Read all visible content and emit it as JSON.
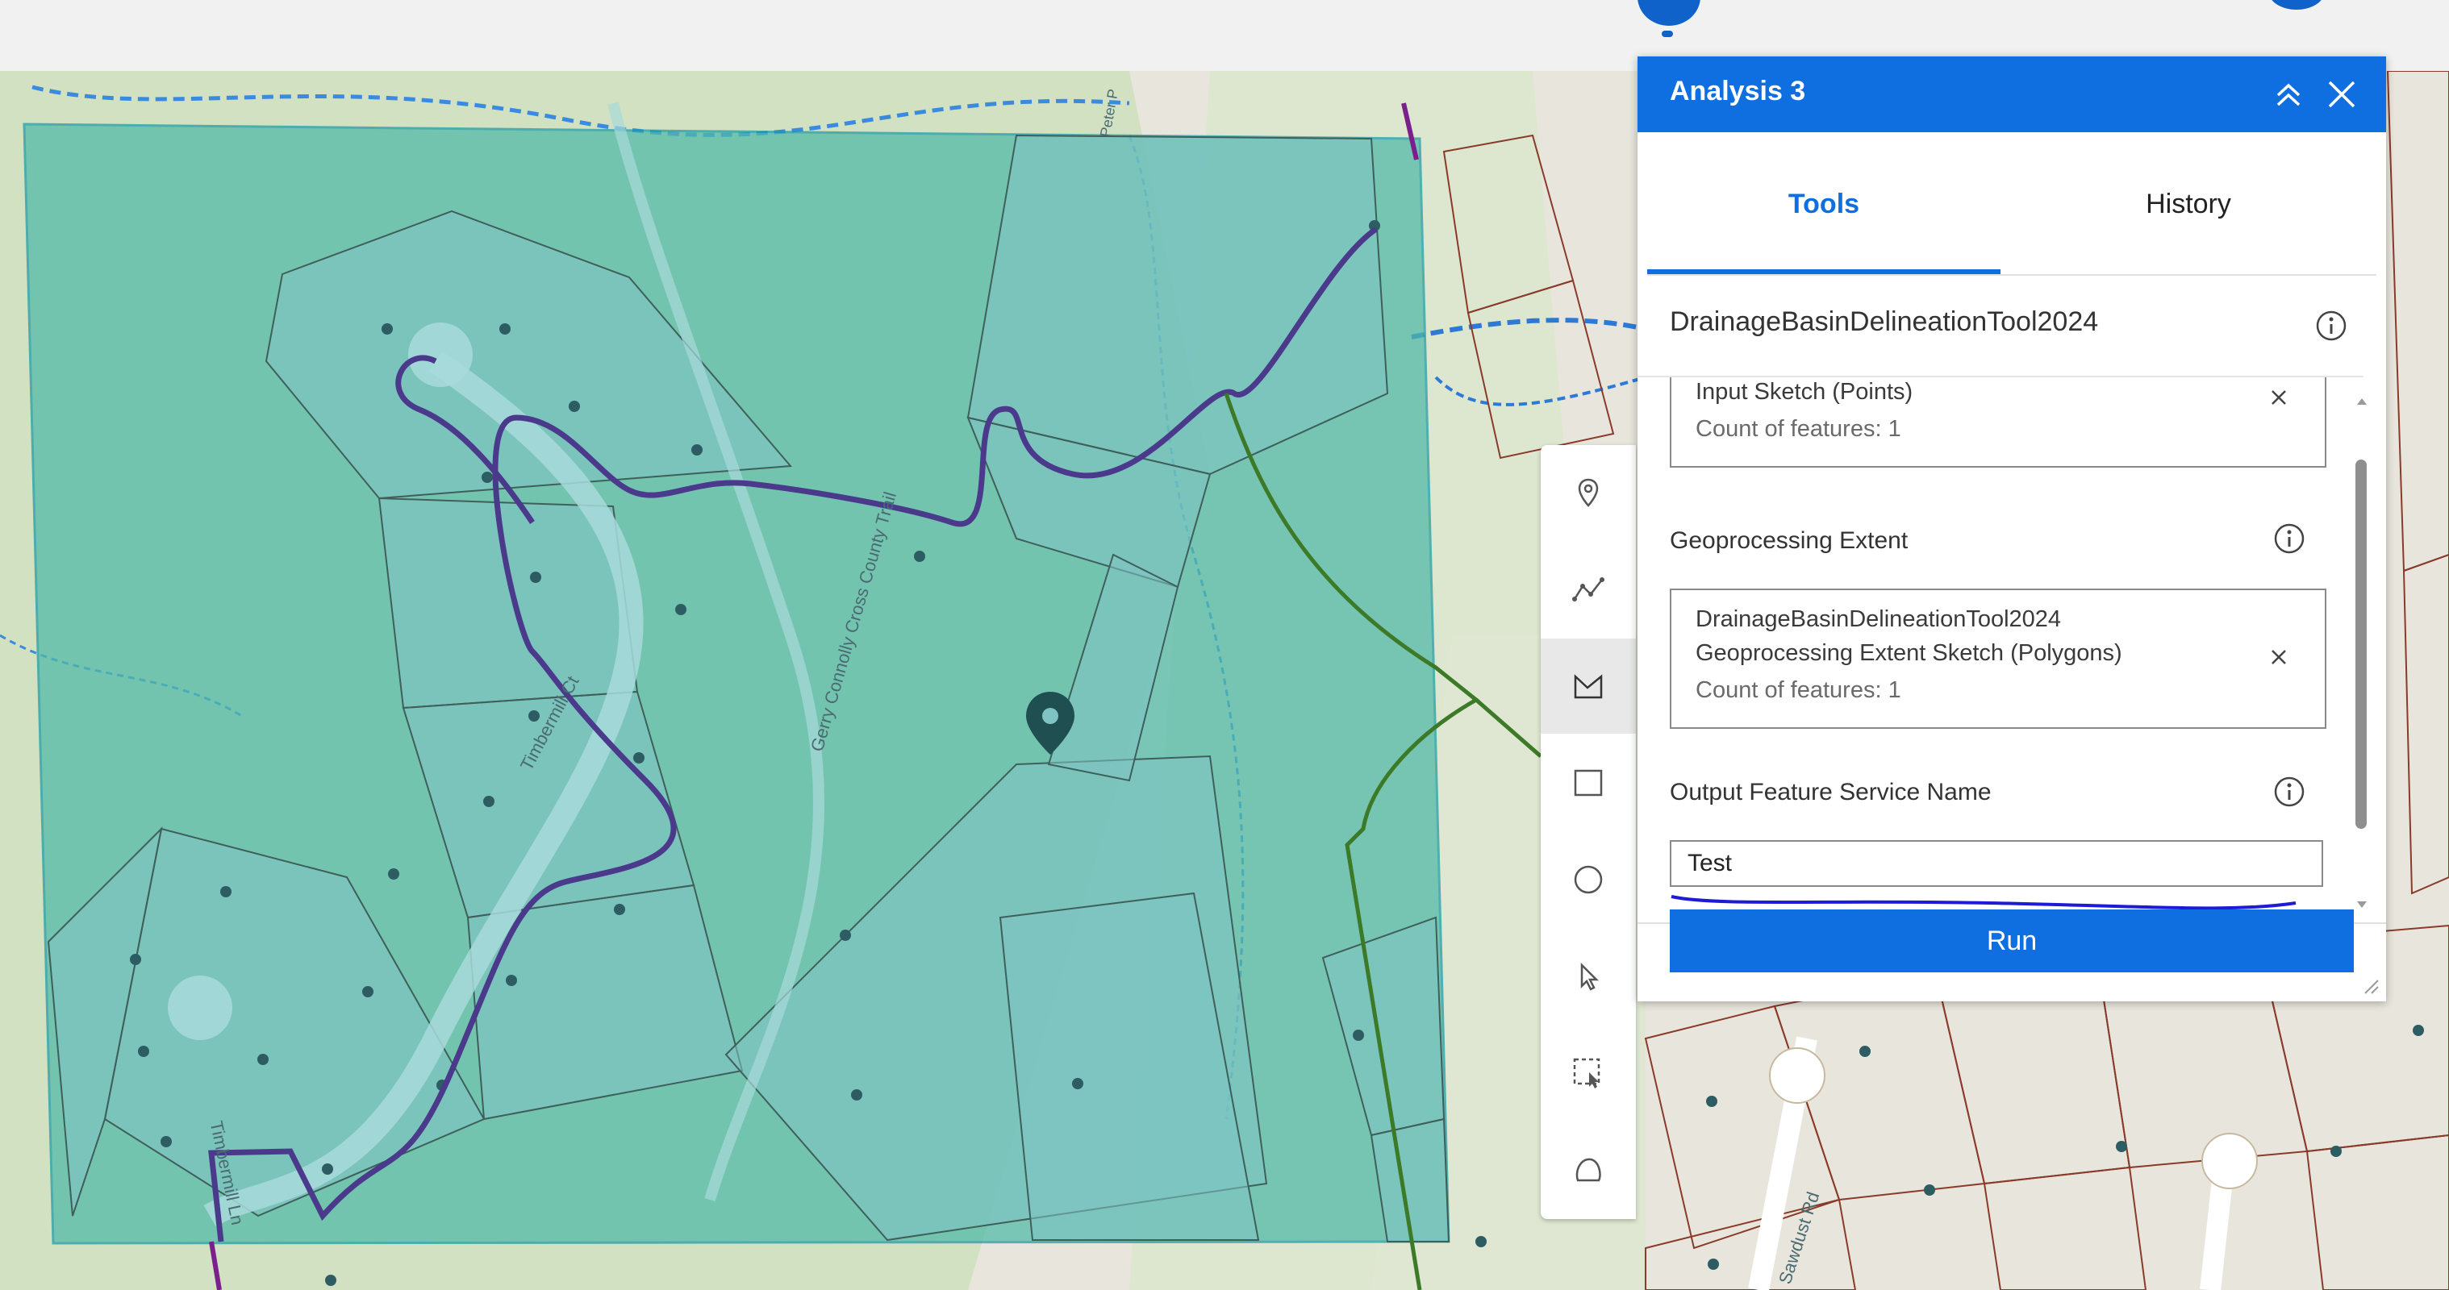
{
  "panel": {
    "title": "Analysis 3",
    "tabs": [
      {
        "label": "Tools",
        "active": true
      },
      {
        "label": "History",
        "active": false
      }
    ],
    "tool_name": "DrainageBasinDelineationTool2024",
    "input_sketch": {
      "title": "Input Sketch (Points)",
      "count": "Count of features: 1"
    },
    "geoprocessing_extent": {
      "label": "Geoprocessing Extent",
      "line1": "DrainageBasinDelineationTool2024",
      "line2": "Geoprocessing Extent Sketch (Polygons)",
      "count": "Count of features: 1"
    },
    "output_name": {
      "label": "Output Feature Service Name",
      "value": "Test"
    },
    "run_label": "Run",
    "accent_color": "#0f6fe0"
  },
  "map": {
    "labels": {
      "timbermill_ct": "Timbermill Ct",
      "gerry_trail": "Gerry Connolly Cross County Trail",
      "timbermill_ln": "Timbermill Ln",
      "sawdust_rd": "Sawdust Rd",
      "peter_rd": "Peter P"
    },
    "sketch_fill_color": "#4fb9a8"
  },
  "toolbar": {
    "tools": [
      "point-icon",
      "polyline-icon",
      "polygon-icon",
      "rectangle-icon",
      "circle-icon",
      "select-icon",
      "select-by-rectangle-icon",
      "lasso-icon"
    ],
    "active_tool": "polygon-icon"
  }
}
